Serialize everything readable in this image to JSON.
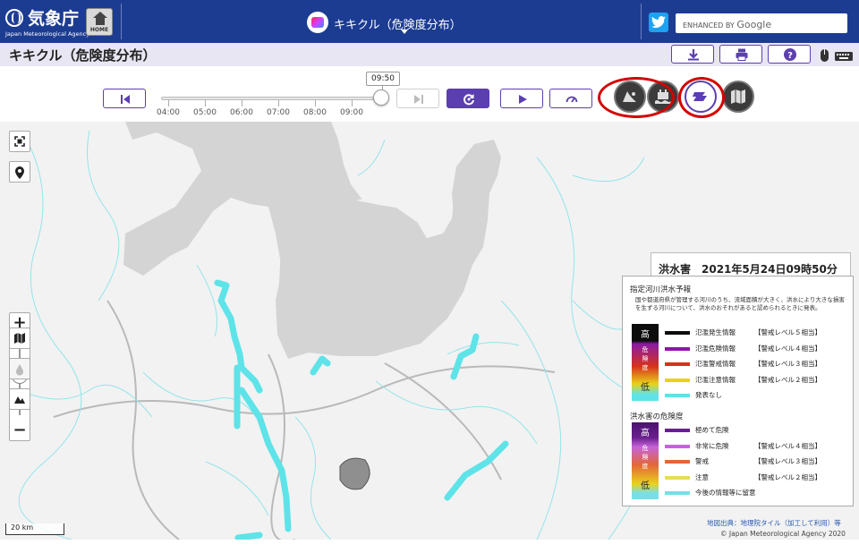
{
  "header": {
    "brand_ja": "気象庁",
    "brand_en": "Japan Meteorological Agency",
    "home_label": "HOME",
    "center_title": "キキクル（危険度分布）",
    "search_placeholder_prefix": "ENHANCED BY",
    "search_placeholder_brand": "Google"
  },
  "page": {
    "title": "キキクル（危険度分布）"
  },
  "toolbar": {
    "download_icon": "download-icon",
    "print_icon": "print-icon",
    "help_icon": "help-icon"
  },
  "timeline": {
    "current_time": "09:50",
    "ticks": [
      "04:00",
      "05:00",
      "06:00",
      "07:00",
      "08:00",
      "09:00"
    ],
    "position": 1.0
  },
  "layers": [
    {
      "name": "landslide",
      "icon": "landslide-layer-icon",
      "active": false
    },
    {
      "name": "inundation",
      "icon": "inundation-layer-icon",
      "active": false
    },
    {
      "name": "flood",
      "icon": "flood-layer-icon",
      "active": true
    },
    {
      "name": "map",
      "icon": "map-layer-icon",
      "active": false
    }
  ],
  "map": {
    "date_label": "洪水害　2021年5月24日09時50分",
    "scale_label": "20 km",
    "attribution_link": "地図出典：地理院タイル（加工して利用）等",
    "copyright": "© Japan Meteorological Agency 2020"
  },
  "legend": {
    "section1_title": "指定河川洪水予報",
    "section1_note": "国や都道府県が管理する河川のうち、流域面積が大きく、洪水により大きな損害を生ずる河川について、洪水のおそれがあると認められるときに発表。",
    "section1_high": "高",
    "section1_mid": "危険度",
    "section1_low": "低",
    "section1_items": [
      {
        "text": "氾濫発生情報",
        "level": "【警戒レベル５相当】",
        "color": "#0c0c0c"
      },
      {
        "text": "氾濫危険情報",
        "level": "【警戒レベル４相当】",
        "color": "#8a1aa3"
      },
      {
        "text": "氾濫警戒情報",
        "level": "【警戒レベル３相当】",
        "color": "#d7311c"
      },
      {
        "text": "氾濫注意情報",
        "level": "【警戒レベル２相当】",
        "color": "#e8d21a"
      },
      {
        "text": "発表なし",
        "level": "",
        "color": "#5de3e8"
      }
    ],
    "section2_title": "洪水害の危険度",
    "section2_high": "高",
    "section2_mid": "危険度",
    "section2_low": "低",
    "section2_items": [
      {
        "text": "極めて危険",
        "level": "",
        "color": "#6a1f8e"
      },
      {
        "text": "非常に危険",
        "level": "【警戒レベル４相当】",
        "color": "#c564d8"
      },
      {
        "text": "警戒",
        "level": "【警戒レベル３相当】",
        "color": "#e3663a"
      },
      {
        "text": "注意",
        "level": "【警戒レベル２相当】",
        "color": "#e4de52"
      },
      {
        "text": "今後の情報等に留意",
        "level": "",
        "color": "#79dfe6"
      }
    ]
  },
  "colors": {
    "header_bg": "#1c3c92",
    "accent": "#5b3fb0",
    "highlight_ring": "#d40000",
    "river": "#5de3e8"
  }
}
